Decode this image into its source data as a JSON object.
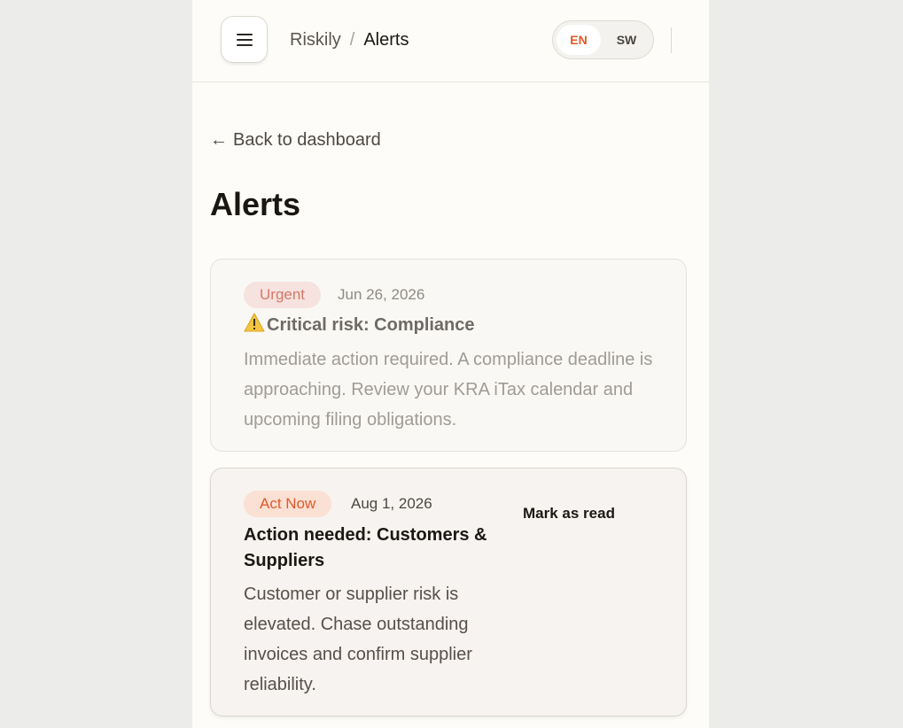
{
  "header": {
    "app_name": "Riskily",
    "separator": "/",
    "current_page": "Alerts",
    "menu_icon": "hamburger-menu-icon",
    "languages": [
      {
        "code": "EN",
        "active": true
      },
      {
        "code": "SW",
        "active": false
      }
    ]
  },
  "back_link": {
    "arrow": "←",
    "label": "Back to dashboard",
    "icon": "arrow-left-icon"
  },
  "page_title": "Alerts",
  "alerts": [
    {
      "badge": "Urgent",
      "date": "Jun 26, 2026",
      "icon": "warning-icon",
      "title": "Critical risk: Compliance",
      "body": "Immediate action required. A compliance deadline is approaching. Review your KRA iTax calendar and upcoming filing obligations.",
      "read": true
    },
    {
      "badge": "Act Now",
      "date": "Aug 1, 2026",
      "title": "Action needed: Customers & Suppliers",
      "body": "Customer or supplier risk is elevated. Chase outstanding invoices and confirm supplier reliability.",
      "action_label": "Mark as read",
      "read": false
    }
  ],
  "colors": {
    "accent": "#e05a25",
    "urgent_badge_bg": "#f6e2de",
    "urgent_badge_text": "#d37a6b",
    "act_badge_bg": "#fbe0d4",
    "act_badge_text": "#e0592a",
    "page_bg": "#fdfcf8",
    "outer_bg": "#ecedea"
  }
}
